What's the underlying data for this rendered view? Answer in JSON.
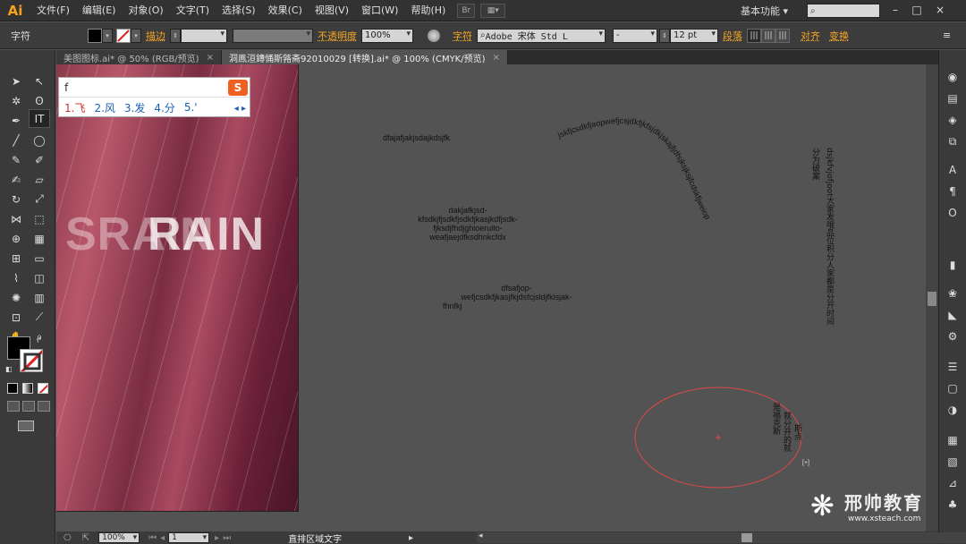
{
  "app": {
    "logo": "Ai"
  },
  "menu": [
    "文件(F)",
    "编辑(E)",
    "对象(O)",
    "文字(T)",
    "选择(S)",
    "效果(C)",
    "视图(V)",
    "窗口(W)",
    "帮助(H)"
  ],
  "header": {
    "workspace": "基本功能",
    "minimize": "–",
    "restore": "□",
    "close": "×"
  },
  "control": {
    "tool_name": "字符",
    "stroke_label": "描边",
    "opacity_label": "不透明度",
    "opacity_value": "100%",
    "char_label": "字符",
    "font_value": "Adobe 宋体 Std L",
    "style_value": "-",
    "size_value": "12 pt",
    "paragraph_label": "段落",
    "align_label": "对齐",
    "transform_label": "变换"
  },
  "tabs": [
    {
      "label": "美图图标.ai* @ 50% (RGB/预览)",
      "close": "×"
    },
    {
      "label": "洞鳯洹鏄悀斯嗠斋92010029 [转换].ai* @ 100% (CMYK/预览)",
      "close": "×"
    }
  ],
  "ime": {
    "input": "f",
    "logo": "S",
    "candidates": [
      "1.飞",
      "2.风",
      "3.发",
      "4.分",
      "5.'"
    ],
    "nav": "◂ ▸"
  },
  "artboard": {
    "title_ghost": "SRAIN",
    "title_main": "RAIN"
  },
  "canvas_text": {
    "line1": "dfajafjakjsdajkdsjfk",
    "block1": [
      "dakjafkjsd-",
      "kfsdkjfjsdkfjsdkfjkasjkdfjsdk-",
      "fjksdjfhdjghioeruito-",
      "weafjaejdfksdhnkcfdx"
    ],
    "block2": [
      "dfsafjop-",
      "wefjcsdkfjkasjfkjdsfcjsldjfklsjak-",
      "fhnfkj"
    ],
    "path_text": "jskfjcsdkfjaopwefjcsjdkfjkfsjdkjskajfjdfsjksjksjfcdskfjweiop",
    "vert_col1": "分为破案",
    "vert_col2": "dsjkfvjofjoot大家发哦品位积分人家都是分开时间",
    "ellipse_col1": "是福克斯",
    "ellipse_col2": "就分开的就",
    "ellipse_col3": "斯点",
    "overflow_mark": "[+]"
  },
  "status": {
    "zoom": "100%",
    "page": "1",
    "tool_desc": "直排区域文字"
  },
  "watermark": {
    "logo": "❋",
    "name": "邢帅教育",
    "url": "www.xsteach.com"
  },
  "colors": {
    "accent": "#f5a623",
    "canvas": "#535353",
    "panel": "#3a3a3a",
    "ellipse": "#e04848"
  }
}
